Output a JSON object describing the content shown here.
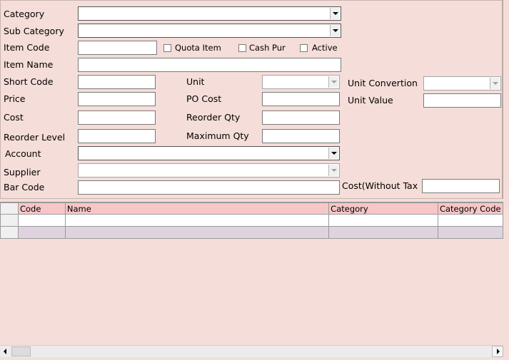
{
  "form": {
    "category_label": "Category",
    "sub_category_label": "Sub Category",
    "item_code_label": "Item Code",
    "quota_item_label": "Quota Item",
    "cash_pur_label": "Cash Pur",
    "active_label": "Active",
    "item_name_label": "Item Name",
    "short_code_label": "Short Code",
    "unit_label": "Unit",
    "unit_convertion_label": "Unit Convertion",
    "price_label": "Price",
    "po_cost_label": "PO Cost",
    "unit_value_label": "Unit Value",
    "cost_label": "Cost",
    "reorder_qty_label": "Reorder Qty",
    "reorder_level_label": "Reorder Level",
    "maximum_qty_label": "Maximum Qty",
    "account_label": "Account",
    "supplier_label": "Supplier",
    "bar_code_label": "Bar Code",
    "cost_without_tax_label": "Cost(Without Tax"
  },
  "grid": {
    "columns": [
      "Code",
      "Name",
      "Category",
      "Category Code"
    ]
  },
  "colors": {
    "background": "#f5ddd9",
    "grid_header": "#f7c6c6",
    "row_alt": "#dfd3df"
  }
}
